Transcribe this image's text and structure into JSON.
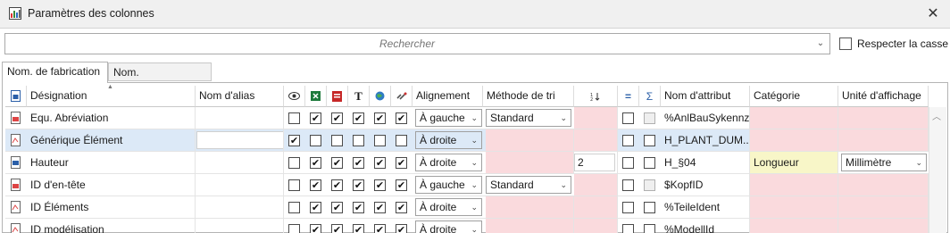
{
  "window": {
    "title": "Paramètres des colonnes",
    "close_icon": "close-icon"
  },
  "search": {
    "placeholder": "Rechercher",
    "value": ""
  },
  "case_sensitive": {
    "label": "Respecter la casse",
    "checked": false
  },
  "tabs": [
    {
      "label": "Nom. de fabrication",
      "active": true
    },
    {
      "label": "Nom. d'assemblage",
      "active": false
    }
  ],
  "columns": {
    "designation": "Désignation",
    "alias": "Nom d'alias",
    "alignment": "Alignement",
    "sort_method": "Méthode de tri",
    "attribute": "Nom d'attribut",
    "category": "Catégorie",
    "unit": "Unité d'affichage",
    "icons": [
      "row-type-icon",
      "eye-icon",
      "excel-icon",
      "pdf-icon",
      "text-icon",
      "globe-icon",
      "link-icon",
      "sort-order-icon",
      "equals-icon",
      "sigma-icon"
    ],
    "sigma_glyph": "Σ",
    "equals_glyph": "="
  },
  "rows": [
    {
      "designation": "Equ. Abréviation",
      "alias": "",
      "checks": [
        false,
        true,
        true,
        true,
        true,
        true
      ],
      "alignment": "À gauche",
      "sort": "Standard",
      "sort_order": "",
      "eq": false,
      "sum": false,
      "attribute": "%AnlBauSykennz",
      "category": "",
      "unit": "",
      "selected": false
    },
    {
      "designation": "Générique Élément",
      "alias": "",
      "checks": [
        true,
        false,
        false,
        false,
        false,
        false
      ],
      "alignment": "À droite",
      "sort": "",
      "sort_order": "",
      "eq": false,
      "sum": false,
      "attribute": "H_PLANT_DUM...",
      "category": "",
      "unit": "",
      "selected": true
    },
    {
      "designation": "Hauteur",
      "alias": "",
      "checks": [
        false,
        true,
        true,
        true,
        true,
        true
      ],
      "alignment": "À droite",
      "sort": "",
      "sort_order": "2",
      "eq": false,
      "sum": false,
      "attribute": "H_§04",
      "category": "Longueur",
      "unit": "Millimètre",
      "selected": false
    },
    {
      "designation": "ID d'en-tête",
      "alias": "",
      "checks": [
        false,
        true,
        true,
        true,
        true,
        true
      ],
      "alignment": "À gauche",
      "sort": "Standard",
      "sort_order": "",
      "eq": false,
      "sum": false,
      "attribute": "$KopfID",
      "category": "",
      "unit": "",
      "selected": false
    },
    {
      "designation": "ID Éléments",
      "alias": "",
      "checks": [
        false,
        true,
        true,
        true,
        true,
        true
      ],
      "alignment": "À droite",
      "sort": "",
      "sort_order": "",
      "eq": false,
      "sum": false,
      "attribute": "%TeileIdent",
      "category": "",
      "unit": "",
      "selected": false
    },
    {
      "designation": "ID modélisation",
      "alias": "",
      "checks": [
        false,
        true,
        true,
        true,
        true,
        true
      ],
      "alignment": "À droite",
      "sort": "",
      "sort_order": "",
      "eq": false,
      "sum": false,
      "attribute": "%ModellId",
      "category": "",
      "unit": "",
      "selected": false
    }
  ],
  "colors": {
    "pink": "#fadadd",
    "yellow": "#f8f6c8",
    "selection": "#dce9f7"
  }
}
